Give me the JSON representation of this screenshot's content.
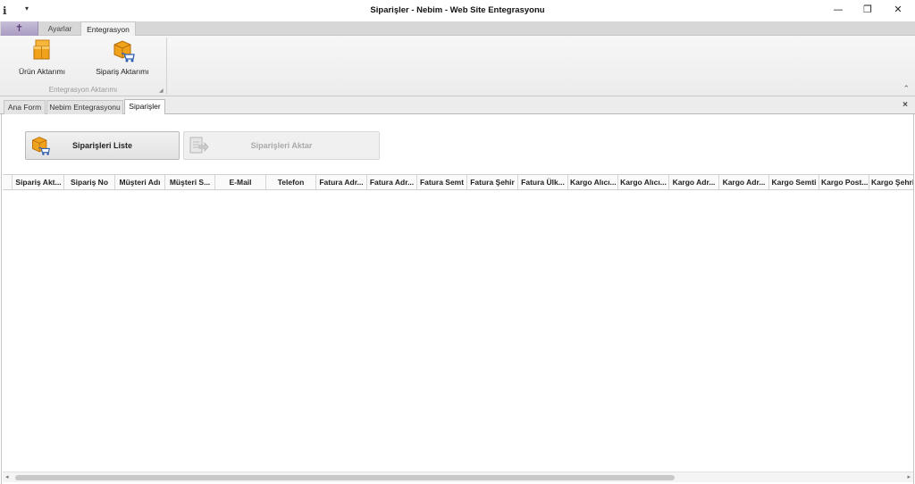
{
  "window": {
    "title": "Siparişler - Nebim - Web Site Entegrasyonu",
    "app_glyph": "ℹ",
    "qa_glyph": "▾",
    "controls": {
      "minimize": "—",
      "restore": "❐",
      "close": "✕"
    }
  },
  "ribbon": {
    "app_menu_glyph": "✝",
    "tabs": [
      "Ayarlar",
      "Entegrasyon"
    ],
    "active_tab": "Entegrasyon",
    "buttons": [
      {
        "label": "Ürün Aktarımı",
        "icon": "box-stack-icon"
      },
      {
        "label": "Sipariş Aktarımı",
        "icon": "box-cart-icon"
      }
    ],
    "group_label": "Entegrasyon Aktarımı",
    "collapse_glyph": "⌃"
  },
  "document_tabs": [
    "Ana Form",
    "Nebim Entegrasyonu",
    "Siparişler"
  ],
  "active_document_tab": "Siparişler",
  "close_glyph": "×",
  "actions": {
    "list_label": "Siparişleri Liste",
    "transfer_label": "Siparişleri Aktar"
  },
  "grid": {
    "columns": [
      "Sipariş Akt...",
      "Sipariş No",
      "Müşteri Adı",
      "Müşteri S...",
      "E-Mail",
      "Telefon",
      "Fatura Adr...",
      "Fatura Adr...",
      "Fatura Semt",
      "Fatura Şehir",
      "Fatura Ülk...",
      "Kargo Alıcı...",
      "Kargo Alıcı...",
      "Kargo Adr...",
      "Kargo Adr...",
      "Kargo Semti",
      "Kargo Post...",
      "Kargo Şehri"
    ],
    "rows": []
  },
  "scrollbar": {
    "left_arrow": "◂",
    "right_arrow": "▸"
  },
  "colors": {
    "ribbon_bg": "#f3f3f3",
    "tab_strip": "#d7d7d7",
    "app_menu": "#a99bc2",
    "icon_orange": "#f0a21b"
  }
}
